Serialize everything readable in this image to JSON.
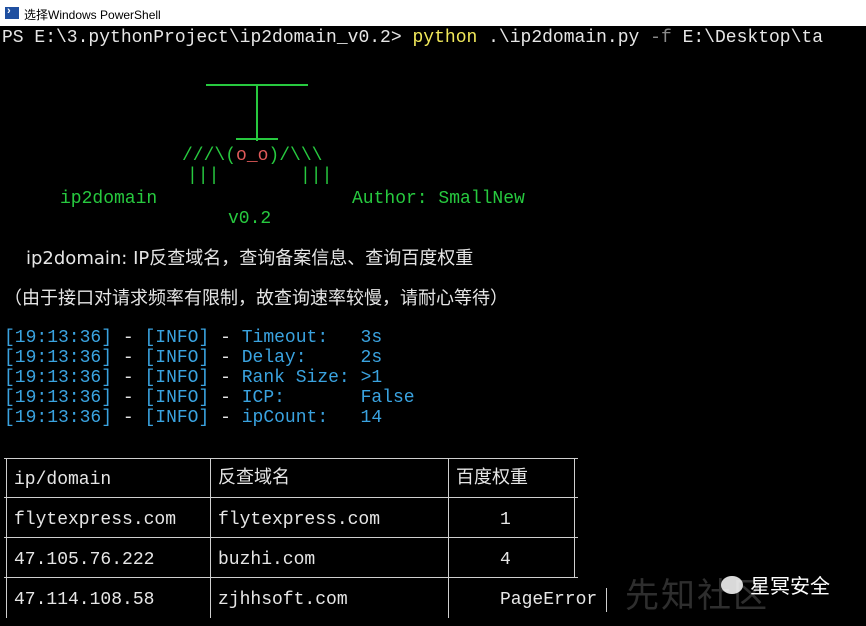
{
  "window": {
    "title": "选择Windows PowerShell"
  },
  "prompt": {
    "ps": "PS E:\\3.pythonProject\\ip2domain_v0.2>",
    "cmd": "python",
    "arg1": ".\\ip2domain.py",
    "flag": "-f",
    "arg2": "E:\\Desktop\\ta"
  },
  "banner": {
    "face_line": "///\\(",
    "face_o": "o_o",
    "face_end": ")/\\\\\\",
    "bars_left": "|||",
    "bars_right": "|||",
    "face_under": "`-'",
    "tool_name": "ip2domain",
    "author": "Author: SmallNew",
    "version": "v0.2"
  },
  "description": {
    "line1": "ip2domain: IP反查域名，查询备案信息、查询百度权重",
    "line2": "（由于接口对请求频率有限制，故查询速率较慢，请耐心等待）"
  },
  "log": [
    {
      "time": "[19:13:36]",
      "level": "[INFO]",
      "key": "Timeout:",
      "value": "3s"
    },
    {
      "time": "[19:13:36]",
      "level": "[INFO]",
      "key": "Delay:",
      "value": "2s"
    },
    {
      "time": "[19:13:36]",
      "level": "[INFO]",
      "key": "Rank Size:",
      "value": ">1"
    },
    {
      "time": "[19:13:36]",
      "level": "[INFO]",
      "key": "ICP:",
      "value": "False"
    },
    {
      "time": "[19:13:36]",
      "level": "[INFO]",
      "key": "ipCount:",
      "value": "14"
    }
  ],
  "log_sep": "-",
  "table": {
    "headers": [
      "ip/domain",
      "反查域名",
      "百度权重"
    ],
    "rows": [
      {
        "ip": "flytexpress.com",
        "domain": "flytexpress.com",
        "rank": "1"
      },
      {
        "ip": "47.105.76.222",
        "domain": "buzhi.com",
        "rank": "4"
      },
      {
        "ip": "47.114.108.58",
        "domain": "zjhhsoft.com",
        "rank": "PageError"
      }
    ]
  },
  "watermark": {
    "brand": "星冥安全",
    "bg_text": "先知社区"
  },
  "colors": {
    "background": "#000000",
    "prompt_cmd": "#f1e95a",
    "flag": "#8a8a8a",
    "logo": "#27c93f",
    "face": "#e05a5a",
    "info": "#3aa3e0",
    "rank_highlight": "#3a7bff",
    "error": "#e05a5a"
  }
}
